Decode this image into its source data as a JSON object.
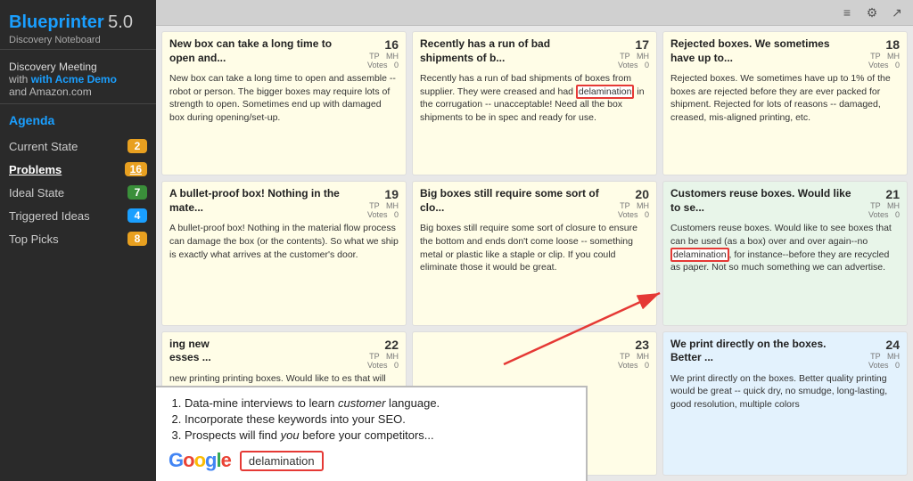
{
  "app": {
    "name": "Blueprinter",
    "version": "5.0",
    "subtitle": "Discovery Noteboard"
  },
  "meeting": {
    "line1": "Discovery Meeting",
    "line2": "with Acme Demo",
    "line3": "and Amazon.com"
  },
  "agenda": {
    "label": "Agenda",
    "items": [
      {
        "id": "current-state",
        "label": "Current State",
        "badge": "2",
        "badge_color": "orange",
        "active": false
      },
      {
        "id": "problems",
        "label": "Problems",
        "badge": "16",
        "badge_color": "orange",
        "active": true
      },
      {
        "id": "ideal-state",
        "label": "Ideal State",
        "badge": "7",
        "badge_color": "green",
        "active": false
      },
      {
        "id": "triggered-ideas",
        "label": "Triggered Ideas",
        "badge": "4",
        "badge_color": "blue",
        "active": false
      },
      {
        "id": "top-picks",
        "label": "Top Picks",
        "badge": "8",
        "badge_color": "orange",
        "active": false
      }
    ]
  },
  "toolbar": {
    "icon1": "≡",
    "icon2": "⚙",
    "icon3": "↗"
  },
  "cards": [
    {
      "id": 16,
      "title": "New box can take a long time to open and...",
      "num": "16",
      "tp": "TP",
      "mh": "MH",
      "votes": "Votes",
      "votes_val": "0",
      "body": "New box can take a long time to open and assemble -- robot or person. The bigger boxes may require lots of strength to open. Sometimes end up with damaged box during opening/set-up.",
      "color": "yellow",
      "highlight": null
    },
    {
      "id": 17,
      "title": "Recently has a run of bad shipments of b...",
      "num": "17",
      "tp": "TP",
      "mh": "MH",
      "votes": "Votes",
      "votes_val": "0",
      "body_pre": "Recently has a run of bad shipments of boxes from supplier. They were creased and had ",
      "body_highlight": "delamination",
      "body_post": " in the corrugation -- unacceptable! Need all the box shipments to be in spec and ready for use.",
      "color": "yellow",
      "highlight": "delamination"
    },
    {
      "id": 18,
      "title": "Rejected boxes. We sometimes have up to...",
      "num": "18",
      "tp": "TP",
      "mh": "MH",
      "votes": "Votes",
      "votes_val": "0",
      "body": "Rejected boxes. We sometimes have up to 1% of the boxes are rejected before they are ever packed for shipment. Rejected for lots of reasons -- damaged, creased, mis-aligned printing, etc.",
      "color": "yellow",
      "highlight": null
    },
    {
      "id": 19,
      "title": "A bullet-proof box! Nothing in the mate...",
      "num": "19",
      "tp": "TP",
      "mh": "MH",
      "votes": "Votes",
      "votes_val": "0",
      "body": "A bullet-proof box! Nothing in the material flow process can damage the box (or the contents). So what we ship is exactly what arrives at the customer's door.",
      "color": "yellow",
      "highlight": null
    },
    {
      "id": 20,
      "title": "Big boxes still require some sort of clo...",
      "num": "20",
      "tp": "TP",
      "mh": "MH",
      "votes": "Votes",
      "votes_val": "0",
      "body": "Big boxes still require some sort of closure to ensure the bottom and ends don't come loose -- something metal or plastic like a staple or clip. If you could eliminate those it would be great.",
      "color": "yellow",
      "highlight": null
    },
    {
      "id": 21,
      "title": "Customers reuse boxes. Would like to se...",
      "num": "21",
      "tp": "TP",
      "mh": "MH",
      "votes": "Votes",
      "votes_val": "0",
      "body_pre": "Customers reuse boxes. Would like to see boxes that can be used (as a box) over and over again--no ",
      "body_highlight": "delamination",
      "body_post": ", for instance--before they are recycled as paper. Not so much something we can advertise.",
      "color": "green",
      "highlight": "delamination"
    },
    {
      "id": 22,
      "title": "ing new esses ...",
      "num": "22",
      "tp": "TP",
      "mh": "MH",
      "votes": "Votes",
      "votes_val": "0",
      "body": "ing new printing boxes. Would like to es that will accept ing technologies with",
      "color": "yellow",
      "highlight": null,
      "partial": true
    },
    {
      "id": 23,
      "title": "23",
      "tp": "TP",
      "mh": "MH",
      "votes": "Votes",
      "votes_val": "0",
      "body": "",
      "color": "yellow",
      "highlight": null
    },
    {
      "id": 24,
      "title": "We print directly on the boxes. Better ...",
      "num": "24",
      "tp": "TP",
      "mh": "MH",
      "votes": "Votes",
      "votes_val": "0",
      "body": "We print directly on the boxes. Better quality printing would be great -- quick dry, no smudge, long-lasting, good resolution, multiple colors",
      "color": "blue",
      "highlight": null
    }
  ],
  "bottom_panel": {
    "items": [
      {
        "text_pre": "Data-mine interviews to learn ",
        "italic": "customer",
        "text_post": " language."
      },
      {
        "text_pre": "Incorporate these keywords into your SEO.",
        "italic": null,
        "text_post": null
      },
      {
        "text_pre": "Prospects will find ",
        "italic": "you",
        "text_post": " before your competitors..."
      }
    ],
    "google_logo": "Google",
    "search_term": "delamination"
  },
  "detected": {
    "new_printing_text": "new printing"
  }
}
